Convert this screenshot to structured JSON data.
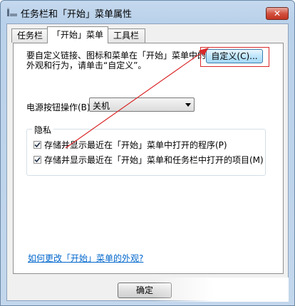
{
  "window": {
    "title": "任务栏和「开始」菜单属性",
    "close_label": "✕"
  },
  "tabs": [
    {
      "label": "任务栏",
      "active": false
    },
    {
      "label": "「开始」菜单",
      "active": true
    },
    {
      "label": "工具栏",
      "active": false
    }
  ],
  "start_menu": {
    "description_line1": "要自定义链接、图标和菜单在「开始」菜单中的",
    "description_line2": "外观和行为，请单击“自定义”。",
    "customize_button": "自定义(C)...",
    "power_label": "电源按钮操作(B):",
    "power_value": "关机",
    "privacy": {
      "title": "隐私",
      "items": [
        {
          "label": "存储并显示最近在「开始」菜单中打开的程序(P)",
          "checked": true
        },
        {
          "label": "存储并显示最近在「开始」菜单和任务栏中打开的项目(M)",
          "checked": true
        }
      ]
    },
    "help_link": "如何更改「开始」菜单的外观?"
  },
  "footer": {
    "ok_button": "确定"
  },
  "colors": {
    "annotation_red": "#d9292a",
    "link_blue": "#0066cc",
    "title_bar": "#b9d1ea"
  }
}
